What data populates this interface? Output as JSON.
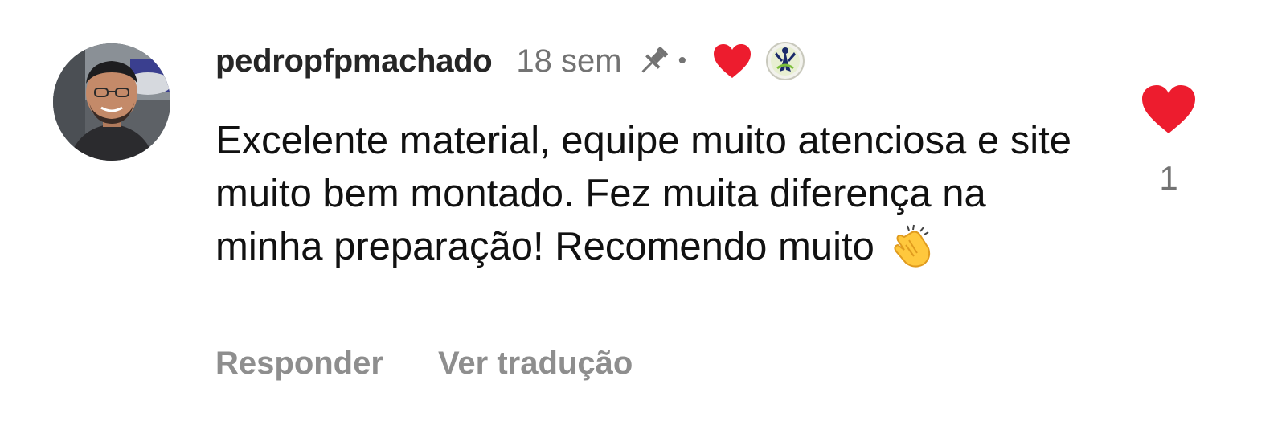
{
  "comment": {
    "username": "pedropfpmachado",
    "time": "18 sem",
    "separator": "•",
    "text": "Excelente material, equipe muito atenciosa e site muito bem montado. Fez muita diferença na minha preparação! Recomendo muito",
    "emoji": "clapping-hands-emoji",
    "icons": {
      "avatar": "avatar",
      "pin": "pin-icon",
      "creator_heart": "heart-icon",
      "badge": "badge-icon",
      "like": "heart-icon"
    },
    "actions": {
      "reply": "Responder",
      "translate": "Ver tradução"
    },
    "likes": "1",
    "colors": {
      "heart": "#ED4956",
      "muted": "#737373",
      "action": "#8e8e8e",
      "text": "#111111"
    }
  }
}
